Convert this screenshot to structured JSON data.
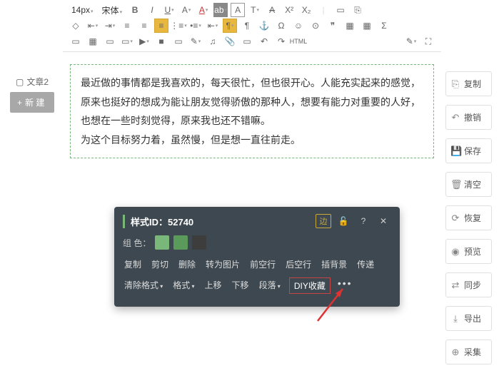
{
  "toolbar": {
    "fontSize": "14px",
    "fontName": "宋体",
    "htmlLabel": "HTML"
  },
  "leftPanel": {
    "docLabel": "文章2",
    "newLabel": "新 建"
  },
  "editor": {
    "line1": "最近做的事情都是我喜欢的，每天很忙，但也很开心。人能充实起来的感觉，原来也挺好的想成为能让朋友觉得骄傲的那种人，想要有能力对重要的人好，也想在一些时刻觉得，原来我也还不错嘛。",
    "line2": "为这个目标努力着，虽然慢，但是想一直往前走。"
  },
  "contextMenu": {
    "titlePrefix": "样式ID：",
    "styleId": "52740",
    "borderLabel": "边",
    "colorLabel": "组 色：",
    "swatches": [
      "#7ab87a",
      "#5a9a5a",
      "#3d3d3d"
    ],
    "row1": [
      "复制",
      "剪切",
      "删除",
      "转为图片",
      "前空行",
      "后空行",
      "插背景",
      "传递"
    ],
    "row2Label1": "清除格式",
    "row2Label2": "格式",
    "row2Label3": "上移",
    "row2Label4": "下移",
    "row2Label5": "段落",
    "row2Label6": "DIY收藏"
  },
  "rightPanel": {
    "copy": "复制",
    "undo": "撤销",
    "save": "保存",
    "clear": "清空",
    "restore": "恢复",
    "preview": "预览",
    "sync": "同步",
    "export": "导出",
    "collect": "采集"
  }
}
